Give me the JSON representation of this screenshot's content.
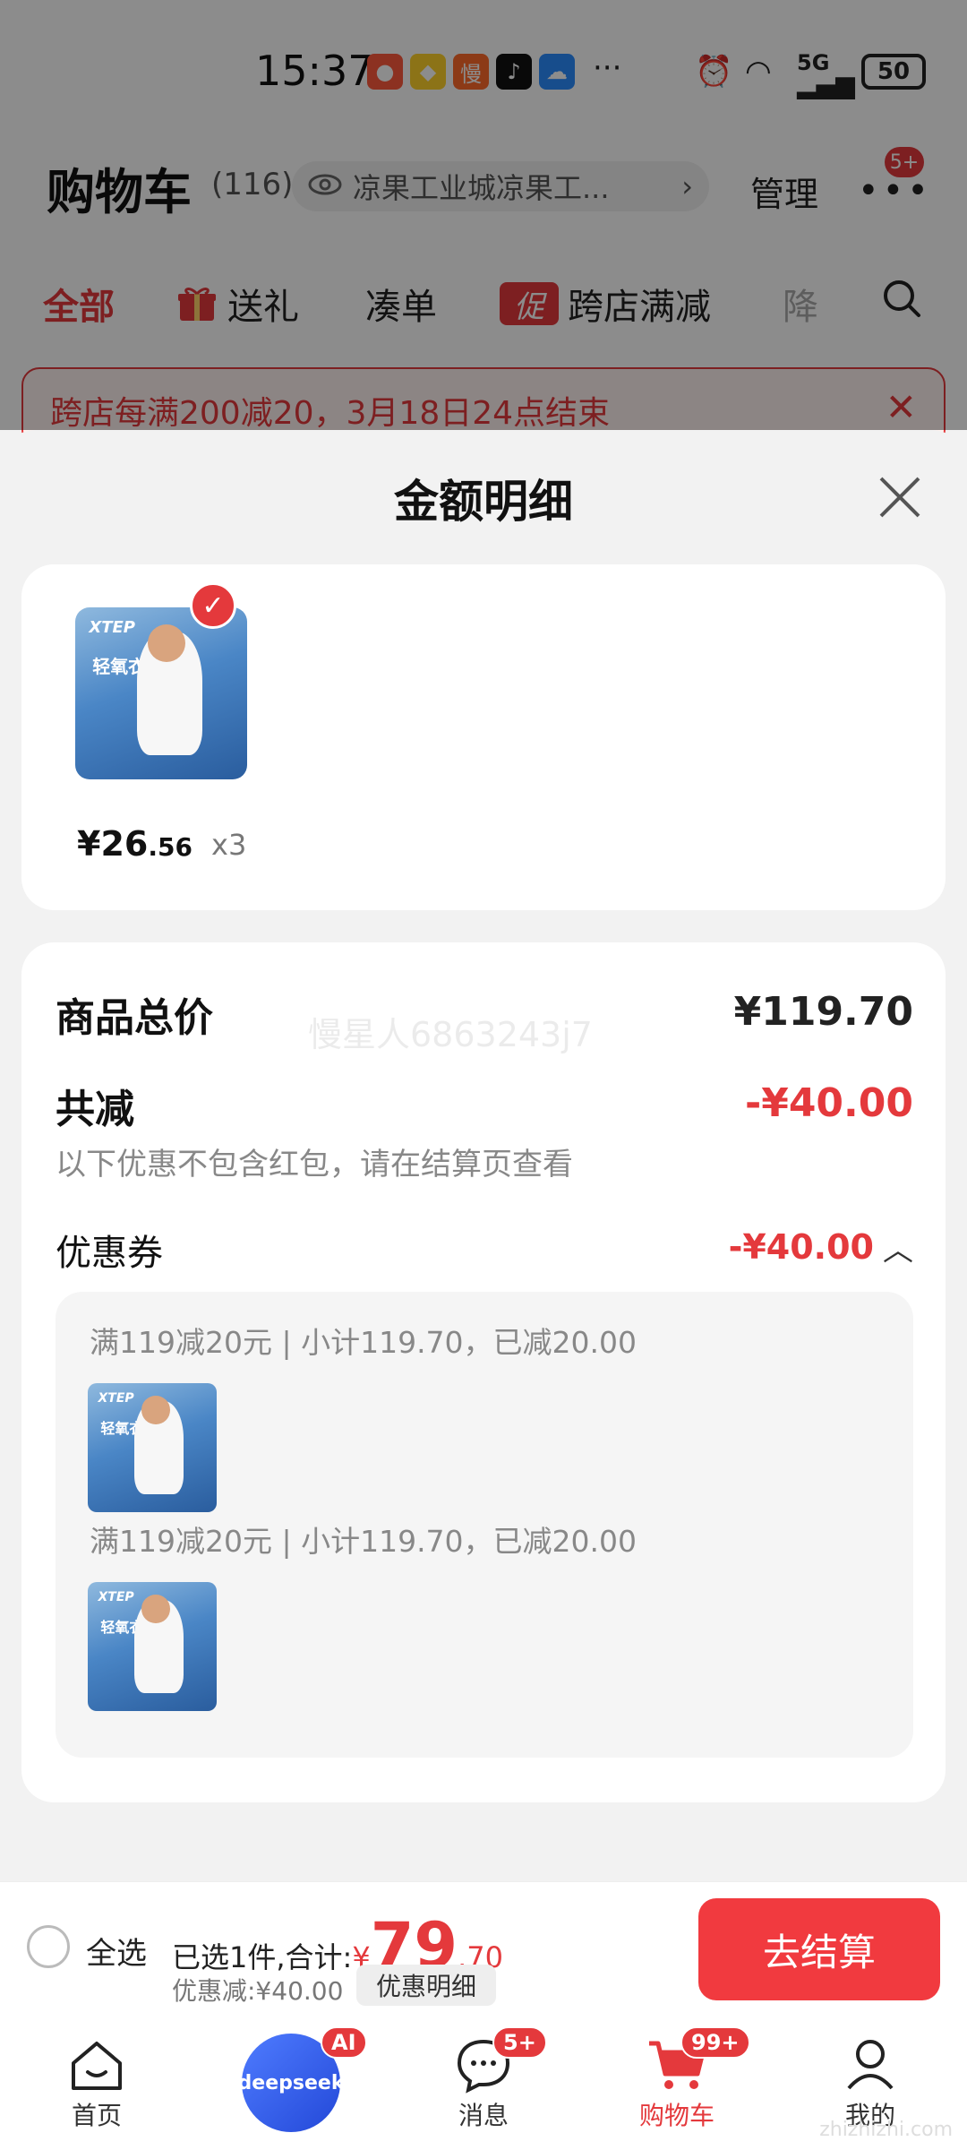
{
  "status_bar": {
    "time": "15:37",
    "battery": "50",
    "app_icons": [
      "notification-icon",
      "baidu-icon",
      "man-icon",
      "tiktok-icon",
      "weather-icon"
    ],
    "more": "···",
    "net": "5G"
  },
  "header": {
    "title": "购物车",
    "count": "(116)",
    "address": "凉果工业城凉果工...",
    "manage": "管理",
    "more_badge": "5+"
  },
  "tabs": {
    "all": "全部",
    "gift": "送礼",
    "combine": "凑单",
    "promo_tag": "促",
    "cross_store": "跨店满减",
    "drop": "降"
  },
  "banner": {
    "text": "跨店每满200减20，3月18日24点结束"
  },
  "sheet": {
    "title": "金额明细",
    "item": {
      "brand": "XTEP",
      "product_text": "轻氧衣",
      "price_int": "¥26",
      "price_dec": ".56",
      "qty": "x3"
    },
    "total_label": "商品总价",
    "total_value": "¥119.70",
    "reduce_label": "共减",
    "reduce_value": "-¥40.00",
    "reduce_note": "以下优惠不包含红包，请在结算页查看",
    "coupon_label": "优惠券",
    "coupon_value": "-¥40.00",
    "watermark": "慢星人6863243j7",
    "coupon_lines": [
      "满119减20元 | 小计119.70，已减20.00",
      "满119减20元 | 小计119.70，已减20.00"
    ]
  },
  "bottom_bar": {
    "select_all": "全选",
    "summary_prefix": "已选1件,合计:",
    "yen": "¥",
    "total_int": "79",
    "total_dec": ".70",
    "discount": "优惠减:¥40.00",
    "detail_button": "优惠明细",
    "checkout": "去结算"
  },
  "nav": {
    "home": "首页",
    "deepseek": "deepseek",
    "ai_badge": "AI",
    "messages": "消息",
    "messages_badge": "5+",
    "cart": "购物车",
    "cart_badge": "99+",
    "mine": "我的"
  },
  "colors": {
    "accent": "#e4393c",
    "checkout": "#f13a3f"
  },
  "site_watermark": "zhizhizhi.com"
}
